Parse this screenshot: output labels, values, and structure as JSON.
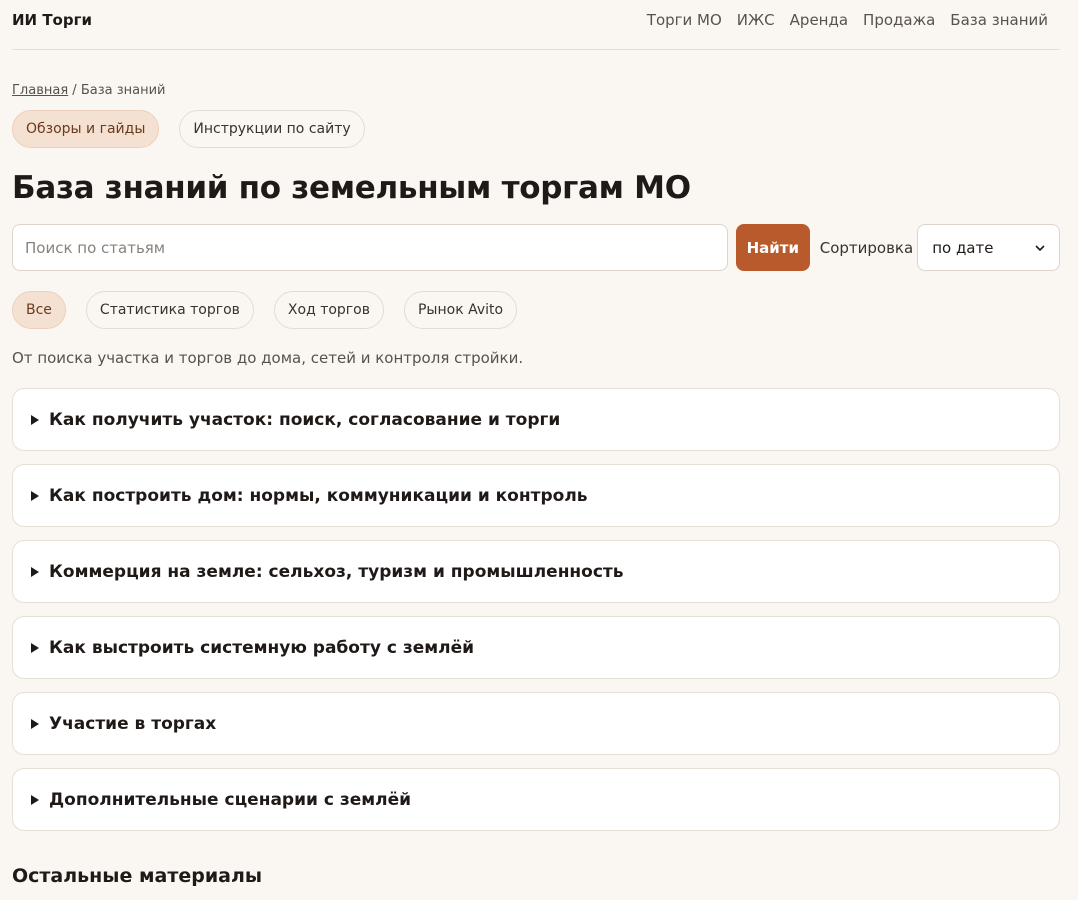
{
  "header": {
    "brand": "ИИ Торги",
    "nav": [
      "Торги МО",
      "ИЖС",
      "Аренда",
      "Продажа",
      "База знаний"
    ]
  },
  "breadcrumb": {
    "home": "Главная",
    "separator": "/",
    "current": "База знаний"
  },
  "sections": [
    {
      "label": "Обзоры и гайды",
      "active": true
    },
    {
      "label": "Инструкции по сайту",
      "active": false
    }
  ],
  "page_title": "База знаний по земельным торгам МО",
  "search": {
    "placeholder": "Поиск по статьям",
    "value": "",
    "button": "Найти",
    "sort_label": "Сортировка",
    "sort_value": "по дате"
  },
  "filters": [
    {
      "label": "Все",
      "active": true
    },
    {
      "label": "Статистика торгов",
      "active": false
    },
    {
      "label": "Ход торгов",
      "active": false
    },
    {
      "label": "Рынок Avito",
      "active": false
    }
  ],
  "intro": "От поиска участка и торгов до дома, сетей и контроля стройки.",
  "accordion": [
    "Как получить участок: поиск, согласование и торги",
    "Как построить дом: нормы, коммуникации и контроль",
    "Коммерция на земле: сельхоз, туризм и промышленность",
    "Как выстроить системную работу с землёй",
    "Участие в торгах",
    "Дополнительные сценарии с землёй"
  ],
  "more_heading": "Остальные материалы",
  "colors": {
    "accent": "#b85a2c",
    "pill_active": "#f5e1d2",
    "background": "#faf6f1"
  }
}
